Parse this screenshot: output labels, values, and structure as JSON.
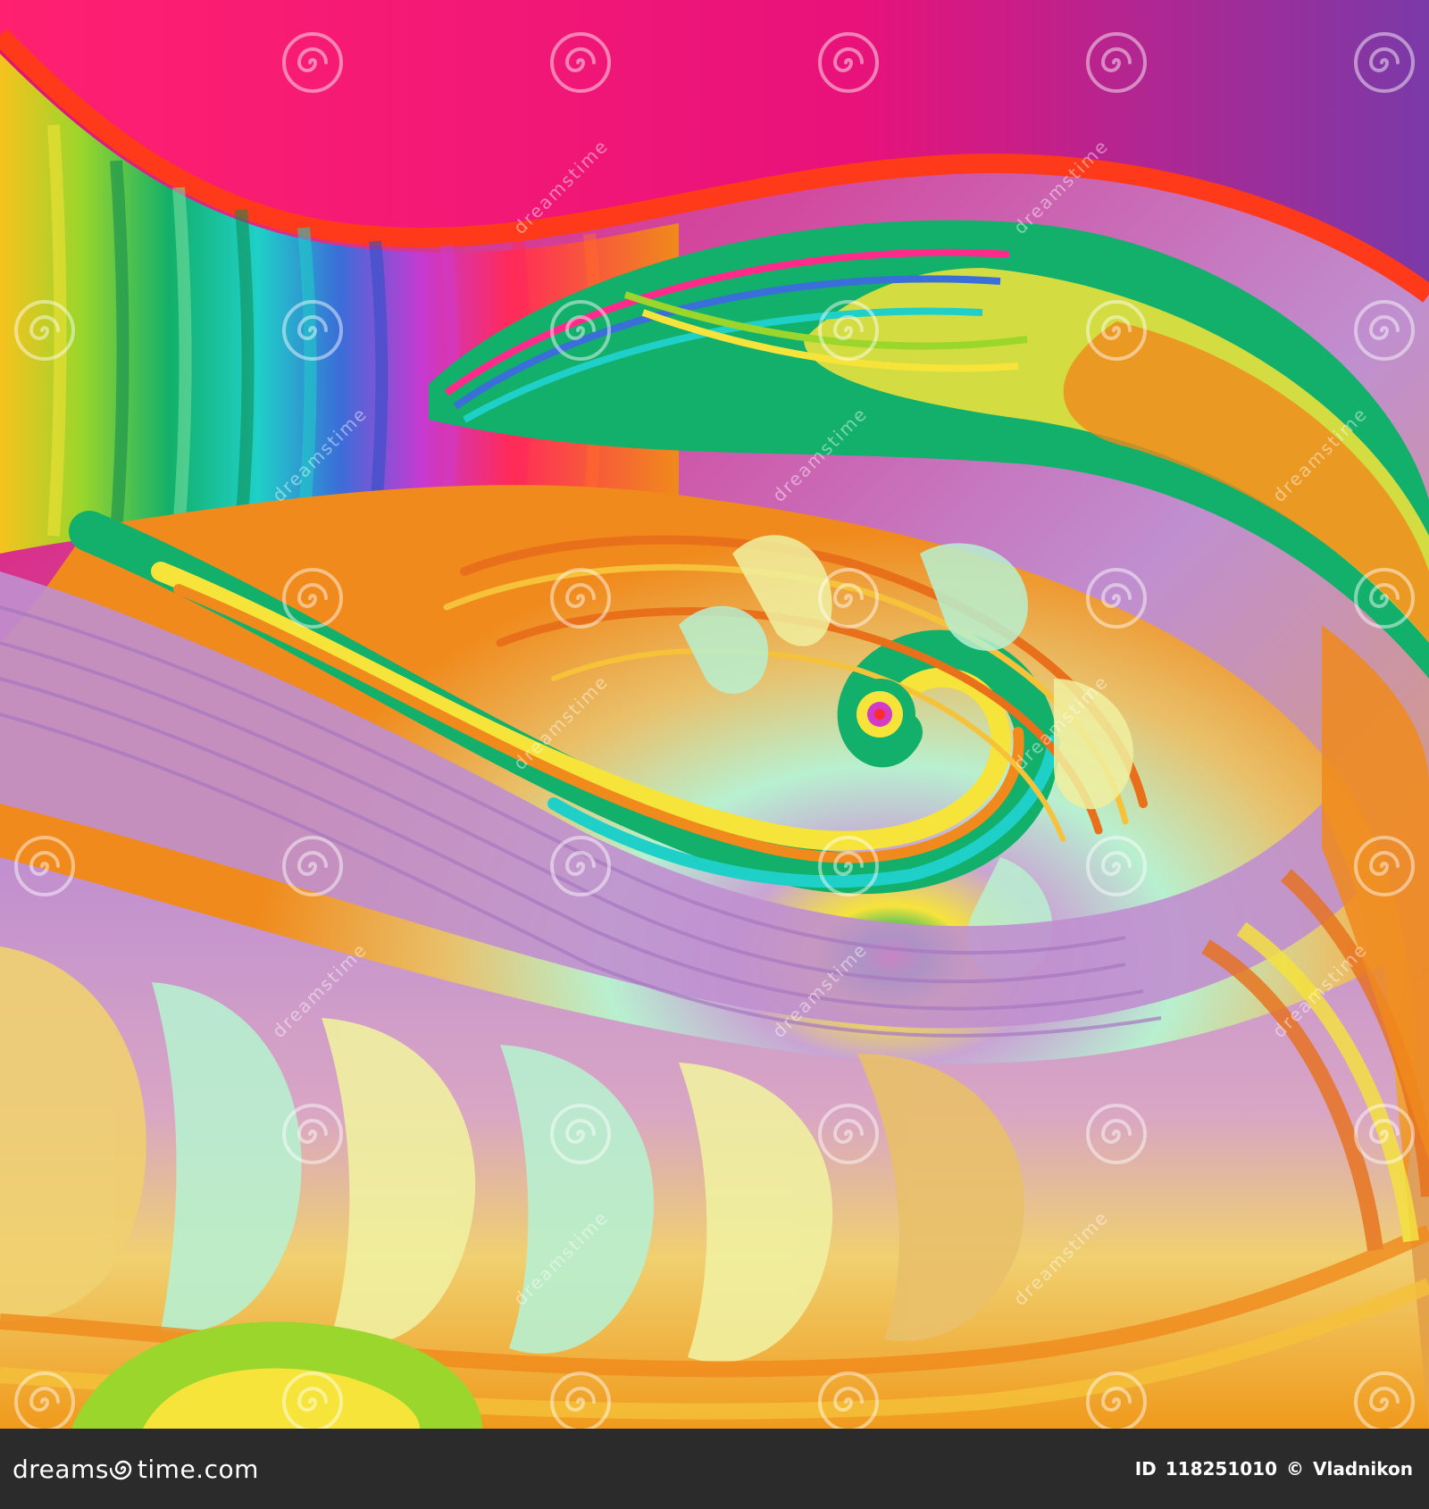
{
  "watermark": {
    "site_text": "dreamstime",
    "icon": "spiral-logo-icon"
  },
  "footer": {
    "logo_prefix": "dreams",
    "logo_suffix": "time.com",
    "id_label": "ID",
    "id_value": "118251010",
    "copyright_symbol": "©",
    "author": "Vladnikon"
  },
  "colors": {
    "magenta": "#e0106e",
    "pink": "#ff2a8a",
    "green": "#12b06a",
    "yellow": "#f6e43a",
    "orange": "#f08a1c",
    "lavender": "#c08fcf",
    "mint": "#b8f0d0",
    "footer_bg": "#2b2b2b"
  }
}
